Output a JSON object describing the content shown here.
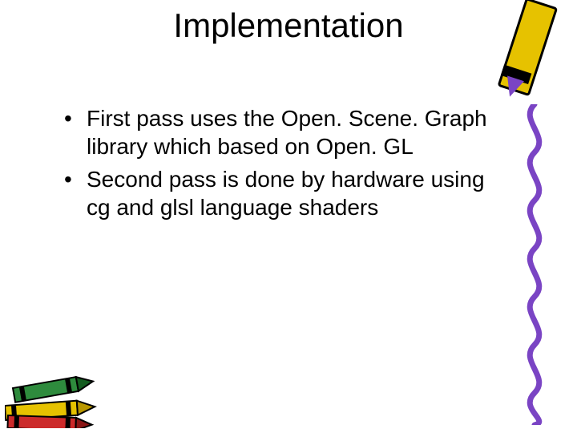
{
  "title": "Implementation",
  "bullets": [
    "First pass uses the Open. Scene. Graph library which based on Open. GL",
    "Second pass is done by hardware using cg and glsl language shaders"
  ]
}
